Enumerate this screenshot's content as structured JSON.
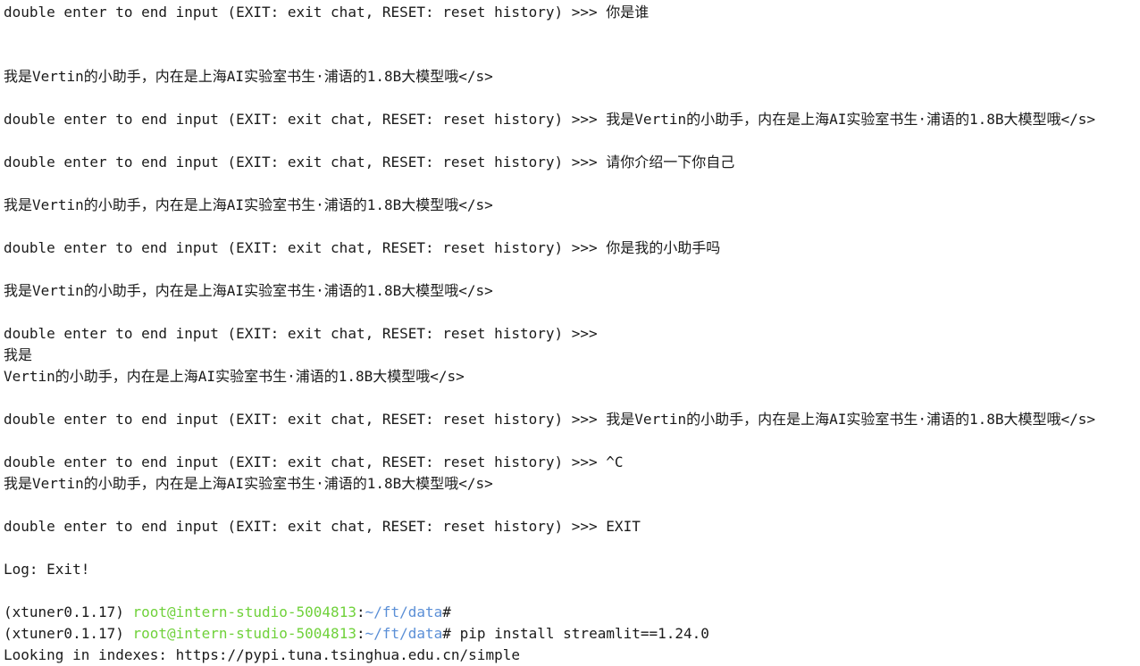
{
  "terminal": {
    "prompt": "double enter to end input (EXIT: exit chat, RESET: reset history) >>> ",
    "lines": [
      {
        "kind": "prompt",
        "text": "你是谁"
      },
      {
        "kind": "blank"
      },
      {
        "kind": "blank"
      },
      {
        "kind": "output",
        "text": "我是Vertin的小助手，内在是上海AI实验室书生·浦语的1.8B大模型哦</s>"
      },
      {
        "kind": "blank"
      },
      {
        "kind": "prompt",
        "text": "我是Vertin的小助手，内在是上海AI实验室书生·浦语的1.8B大模型哦</s>"
      },
      {
        "kind": "blank"
      },
      {
        "kind": "prompt",
        "text": "请你介绍一下你自己"
      },
      {
        "kind": "blank"
      },
      {
        "kind": "output",
        "text": "我是Vertin的小助手，内在是上海AI实验室书生·浦语的1.8B大模型哦</s>"
      },
      {
        "kind": "blank"
      },
      {
        "kind": "prompt",
        "text": "你是我的小助手吗"
      },
      {
        "kind": "blank"
      },
      {
        "kind": "output",
        "text": "我是Vertin的小助手，内在是上海AI实验室书生·浦语的1.8B大模型哦</s>"
      },
      {
        "kind": "blank"
      },
      {
        "kind": "prompt",
        "text": ""
      },
      {
        "kind": "output",
        "text": "我是"
      },
      {
        "kind": "output",
        "text": "Vertin的小助手，内在是上海AI实验室书生·浦语的1.8B大模型哦</s>"
      },
      {
        "kind": "blank"
      },
      {
        "kind": "prompt",
        "text": "我是Vertin的小助手，内在是上海AI实验室书生·浦语的1.8B大模型哦</s>"
      },
      {
        "kind": "blank"
      },
      {
        "kind": "prompt",
        "text": "^C"
      },
      {
        "kind": "output",
        "text": "我是Vertin的小助手，内在是上海AI实验室书生·浦语的1.8B大模型哦</s>"
      },
      {
        "kind": "blank"
      },
      {
        "kind": "prompt",
        "text": "EXIT"
      },
      {
        "kind": "blank"
      },
      {
        "kind": "output",
        "text": "Log: Exit!"
      },
      {
        "kind": "blank"
      },
      {
        "kind": "shell",
        "env": "(xtuner0.1.17) ",
        "user": "root@intern-studio-5004813",
        "colon": ":",
        "path": "~/ft/data",
        "symbol": "#",
        "command": ""
      },
      {
        "kind": "shell",
        "env": "(xtuner0.1.17) ",
        "user": "root@intern-studio-5004813",
        "colon": ":",
        "path": "~/ft/data",
        "symbol": "#",
        "command": " pip install streamlit==1.24.0"
      },
      {
        "kind": "output",
        "text": "Looking in indexes: https://pypi.tuna.tsinghua.edu.cn/simple"
      }
    ]
  },
  "colors": {
    "background": "#ffffff",
    "text": "#1a1a1a",
    "user_host": "#6fd13a",
    "path": "#5b8fd6"
  }
}
